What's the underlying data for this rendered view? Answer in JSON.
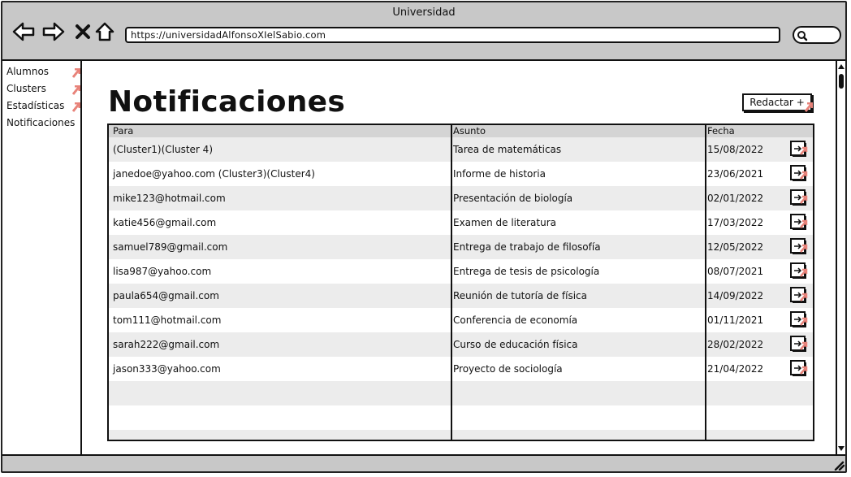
{
  "window": {
    "title": "Universidad",
    "url": "https://universidadAlfonsoXIelSabio.com",
    "nav_icons": [
      "back-arrow-icon",
      "forward-arrow-icon",
      "close-x-icon",
      "home-icon"
    ],
    "search_icon": "search-icon"
  },
  "sidebar": {
    "items": [
      {
        "label": "Alumnos",
        "has_link": true
      },
      {
        "label": "Clusters",
        "has_link": true
      },
      {
        "label": "Estadísticas",
        "has_link": true
      },
      {
        "label": "Notificaciones",
        "has_link": false
      }
    ]
  },
  "main": {
    "title": "Notificaciones",
    "compose_label": "Redactar +"
  },
  "table": {
    "columns": [
      "Para",
      "Asunto",
      "Fecha"
    ],
    "rows": [
      {
        "para": "(Cluster1)(Cluster 4)",
        "asunto": "Tarea de matemáticas",
        "fecha": "15/08/2022"
      },
      {
        "para": "janedoe@yahoo.com (Cluster3)(Cluster4)",
        "asunto": "Informe de historia",
        "fecha": "23/06/2021"
      },
      {
        "para": "mike123@hotmail.com",
        "asunto": "Presentación de biología",
        "fecha": "02/01/2022"
      },
      {
        "para": "katie456@gmail.com",
        "asunto": "Examen de literatura",
        "fecha": "17/03/2022"
      },
      {
        "para": "samuel789@gmail.com",
        "asunto": "Entrega de trabajo de filosofía",
        "fecha": "12/05/2022"
      },
      {
        "para": "lisa987@yahoo.com",
        "asunto": "Entrega de tesis de psicología",
        "fecha": "08/07/2021"
      },
      {
        "para": "paula654@gmail.com",
        "asunto": "Reunión de tutoría de física",
        "fecha": "14/09/2022"
      },
      {
        "para": "tom111@hotmail.com",
        "asunto": "Conferencia de economía",
        "fecha": "01/11/2021"
      },
      {
        "para": "sarah222@gmail.com",
        "asunto": "Curso de educación física",
        "fecha": "28/02/2022"
      },
      {
        "para": "jason333@yahoo.com",
        "asunto": "Proyecto de sociología",
        "fecha": "21/04/2022"
      }
    ],
    "empty_rows": 3,
    "row_action_icon": "open-message-icon"
  },
  "colors": {
    "chrome": "#c8c8c8",
    "stripe": "#ececec",
    "header": "#d4d4d4",
    "link_flag": "#e8837a",
    "ink": "#111111"
  }
}
